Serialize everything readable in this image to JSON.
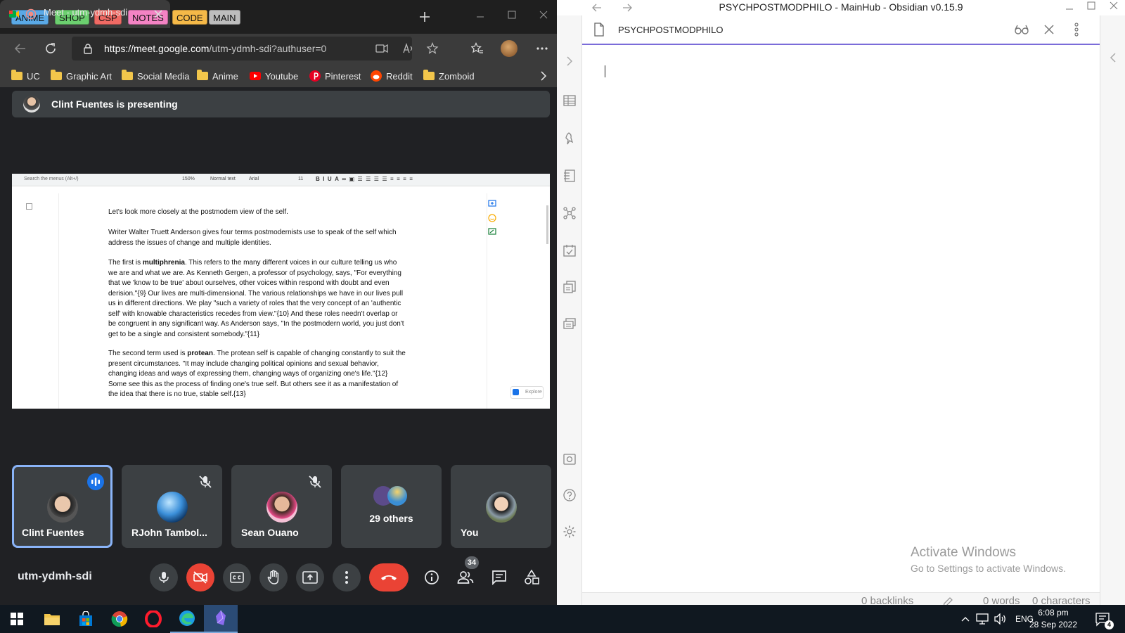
{
  "browser": {
    "tab_groups": [
      {
        "label": "ANIME",
        "color": "#5aa9e6"
      },
      {
        "label": "SHOP",
        "color": "#6ccf6f"
      },
      {
        "label": "CSP",
        "color": "#f06a64"
      },
      {
        "label": "NOTES",
        "color": "#f483c4"
      },
      {
        "label": "CODE",
        "color": "#f5b948"
      },
      {
        "label": "MAIN",
        "color": "#bdbdbd"
      }
    ],
    "active_tab_title": "Meet - utm-ydmh-sdi",
    "url_host": "https://meet.google.com",
    "url_path": "/utm-ydmh-sdi?authuser=0",
    "bookmarks": [
      "UC",
      "Graphic Art",
      "Social Media",
      "Anime",
      "Youtube",
      "Pinterest",
      "Reddit",
      "Zomboid"
    ]
  },
  "meet": {
    "presenting_text": "Clint Fuentes is presenting",
    "meeting_code": "utm-ydmh-sdi",
    "participant_count_badge": "34",
    "tiles": [
      {
        "name": "Clint Fuentes",
        "speaking": true
      },
      {
        "name": "RJohn Tambol...",
        "muted": true
      },
      {
        "name": "Sean Ouano",
        "muted": true
      },
      {
        "name": "29 others"
      },
      {
        "name": "You"
      }
    ],
    "accent": "#8ab4f8",
    "end_call_color": "#ea4335"
  },
  "doc": {
    "toolbar": {
      "search": "Search the menus (Alt+/)",
      "zoom": "150%",
      "style": "Normal text",
      "font": "Arial",
      "size": "11"
    },
    "explore_label": "Explore",
    "paragraphs": [
      [
        "Let's look more closely at the postmodern view of the self."
      ],
      [
        "Writer Walter Truett Anderson gives four terms postmodernists use to speak of the self which",
        "address the issues of change and multiple identities."
      ],
      [
        "The first is multiphrenia. This refers to the many different voices in our culture telling us who",
        "we are and what we are. As Kenneth Gergen, a professor of psychology, says, \"For everything",
        "that we 'know to be true' about ourselves, other voices within respond with doubt and even",
        "derision.\"{9} Our lives are multi-dimensional. The various relationships we have in our lives pull",
        "us in different directions. We play \"such a variety of roles that the very concept of an 'authentic",
        "self' with knowable characteristics recedes from view.\"{10} And these roles needn't overlap or",
        "be congruent in any significant way. As Anderson says, \"In the postmodern world, you just don't",
        "get to be a single and consistent somebody.\"{11}"
      ],
      [
        "The second term used is protean. The protean self is capable of changing constantly to suit the",
        "present circumstances. \"It may include changing political opinions and sexual behavior,",
        "changing ideas and ways of expressing them, changing ways of organizing one's life.\"{12}",
        "Some see this as the process of finding one's true self. But others see it as a manifestation of",
        "the idea that there is no true, stable self.{13}"
      ]
    ]
  },
  "obsidian": {
    "window_title": "PSYCHPOSTMODPHILO - MainHub - Obsidian v0.15.9",
    "note_title": "PSYCHPOSTMODPHILO",
    "status_backlinks": "0 backlinks",
    "status_words": "0 words",
    "status_chars": "0 characters",
    "accent": "#7b6cd9"
  },
  "watermark": {
    "line1": "Activate Windows",
    "line2": "Go to Settings to activate Windows."
  },
  "taskbar": {
    "lang": "ENG",
    "time": "6:08 pm",
    "date": "28 Sep 2022",
    "notif_count": "4"
  }
}
